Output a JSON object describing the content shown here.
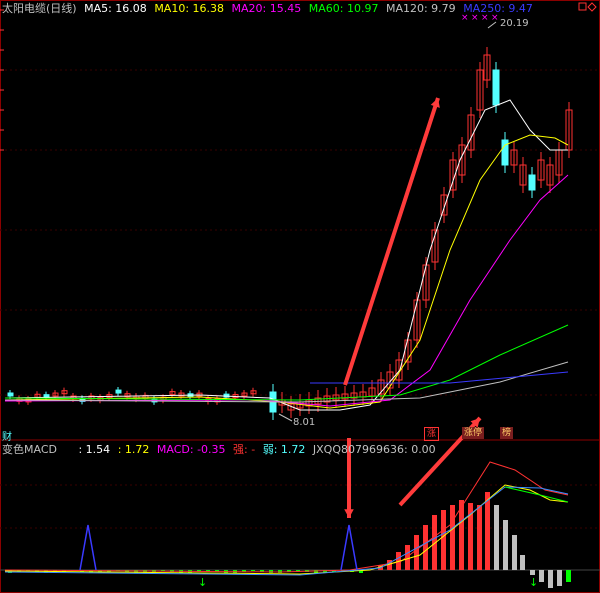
{
  "app": {
    "title": "太阳电缆(日线)"
  },
  "header": {
    "ma5": "MA5: 16.08",
    "ma10": "MA10: 16.38",
    "ma20": "MA20: 15.45",
    "ma60": "MA60: 10.97",
    "ma120": "MA120: 9.79",
    "ma250": "MA250: 9.47"
  },
  "price_panel": {
    "high_label": "20.19",
    "low_label": "8.01",
    "left_tag": "财",
    "badges": [
      "涨",
      "涨停",
      "榜"
    ]
  },
  "macd_panel": {
    "title": "变色MACD",
    "v1": ": 1.54",
    "v2": ": 1.72",
    "macd": "MACD: -0.35",
    "strong": "强: -",
    "weak": "弱: 1.72",
    "extra": "JXQQ807969636: 0.00"
  },
  "colors": {
    "up": "#ff3232",
    "down": "#54ffff",
    "ma5": "#ffffff",
    "ma10": "#ffff00",
    "ma20": "#ff00ff",
    "ma60": "#00ff00",
    "ma120": "#c0c0c0",
    "ma250": "#3a3aff",
    "arrow": "#ff3b3b"
  }
}
